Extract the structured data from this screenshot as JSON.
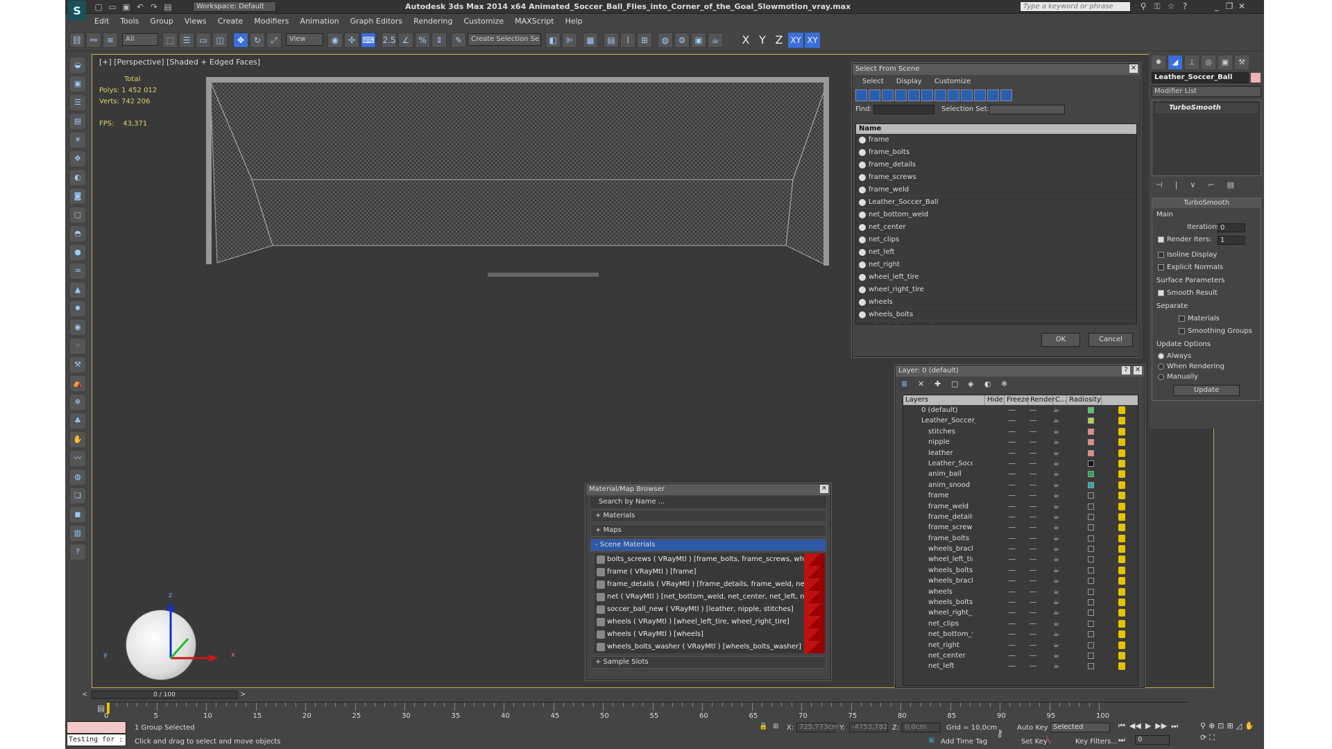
{
  "app": {
    "title": "Autodesk 3ds Max  2014 x64     Animated_Soccer_Ball_Flies_into_Corner_of_the_Goal_Slowmotion_vray.max",
    "workspace": "Workspace: Default",
    "search_placeholder": "Type a keyword or phrase"
  },
  "menu": [
    "Edit",
    "Tools",
    "Group",
    "Views",
    "Create",
    "Modifiers",
    "Animation",
    "Graph Editors",
    "Rendering",
    "Customize",
    "MAXScript",
    "Help"
  ],
  "toolbar": {
    "filter": "All",
    "refcoord": "View",
    "angle": "2.5",
    "selection_set": "Create Selection Se",
    "axes": [
      "X",
      "Y",
      "Z",
      "XY",
      "XY"
    ]
  },
  "viewport": {
    "label": "[+] [Perspective] [Shaded + Edged Faces]",
    "stats_header": "Total",
    "polys_label": "Polys:",
    "polys": "1 452 012",
    "verts_label": "Verts:",
    "verts": "742 206",
    "fps_label": "FPS:",
    "fps": "43,371",
    "axis_x": "x",
    "axis_y": "y",
    "axis_z": "z"
  },
  "select_from_scene": {
    "title": "Select From Scene",
    "menu": [
      "Select",
      "Display",
      "Customize"
    ],
    "find_label": "Find:",
    "selection_set_label": "Selection Set:",
    "column_name": "Name",
    "items": [
      "frame",
      "frame_bolts",
      "frame_details",
      "frame_screws",
      "frame_weld",
      "Leather_Soccer_Ball",
      "net_bottom_weld",
      "net_center",
      "net_clips",
      "net_left",
      "net_right",
      "wheel_left_tire",
      "wheel_right_tire",
      "wheels",
      "wheels_bolts",
      "wheels_bolts_washer"
    ],
    "ok": "OK",
    "cancel": "Cancel"
  },
  "material_browser": {
    "title": "Material/Map Browser",
    "search": "Search by Name ...",
    "materials": "+ Materials",
    "maps": "+ Maps",
    "scene_materials": "- Scene Materials",
    "sample_slots": "+ Sample Slots",
    "items": [
      "bolts_screws  ( VRayMtl ) [frame_bolts, frame_screws, wheels_bolts, wheels_br...",
      "frame  ( VRayMtl ) [frame]",
      "frame_details  ( VRayMtl ) [frame_details, frame_weld, net_clips, wheels_bracket]",
      "net  ( VRayMtl ) [net_bottom_weld, net_center, net_left, net_right]",
      "soccer_ball_new  ( VRayMtl ) [leather, nipple, stitches]",
      "wheels  ( VRayMtl ) [wheel_left_tire, wheel_right_tire]",
      "wheels  ( VRayMtl ) [wheels]",
      "wheels_bolts_washer  ( VRayMtl ) [wheels_bolts_washer]"
    ]
  },
  "layers": {
    "title": "Layer: 0 (default)",
    "help": "?",
    "columns": [
      "Layers",
      "Hide",
      "Freeze",
      "Render",
      "C...",
      "Radiosity"
    ],
    "rows": [
      {
        "name": "0 (default)",
        "level": 0,
        "color": "#44cc66"
      },
      {
        "name": "Leather_Soccer_Bal",
        "level": 0,
        "color": "#aadd44"
      },
      {
        "name": "stitches",
        "level": 1,
        "color": "#ee8888"
      },
      {
        "name": "nipple",
        "level": 1,
        "color": "#ee8888"
      },
      {
        "name": "leather",
        "level": 1,
        "color": "#ee8888"
      },
      {
        "name": "Leather_Soccer_",
        "level": 1,
        "color": "#111111"
      },
      {
        "name": "anim_ball",
        "level": 1,
        "color": "#22aa55"
      },
      {
        "name": "anim_snood",
        "level": 1,
        "color": "#22aaaa"
      },
      {
        "name": "frame",
        "level": 1,
        "color": ""
      },
      {
        "name": "frame_weld",
        "level": 1,
        "color": ""
      },
      {
        "name": "frame_details",
        "level": 1,
        "color": ""
      },
      {
        "name": "frame_screws",
        "level": 1,
        "color": ""
      },
      {
        "name": "frame_bolts",
        "level": 1,
        "color": ""
      },
      {
        "name": "wheels_bracket",
        "level": 1,
        "color": ""
      },
      {
        "name": "wheel_left_tire",
        "level": 1,
        "color": ""
      },
      {
        "name": "wheels_bolts_wa",
        "level": 1,
        "color": ""
      },
      {
        "name": "wheels_bracket_",
        "level": 1,
        "color": ""
      },
      {
        "name": "wheels",
        "level": 1,
        "color": ""
      },
      {
        "name": "wheels_bolts",
        "level": 1,
        "color": ""
      },
      {
        "name": "wheel_right_tire",
        "level": 1,
        "color": ""
      },
      {
        "name": "net_clips",
        "level": 1,
        "color": ""
      },
      {
        "name": "net_bottom_wel",
        "level": 1,
        "color": ""
      },
      {
        "name": "net_right",
        "level": 1,
        "color": ""
      },
      {
        "name": "net_center",
        "level": 1,
        "color": ""
      },
      {
        "name": "net_left",
        "level": 1,
        "color": ""
      }
    ]
  },
  "command_panel": {
    "object_name": "Leather_Soccer_Ball",
    "modifier_list": "Modifier List",
    "stack_item": "TurboSmooth",
    "rollout": "TurboSmooth",
    "main": "Main",
    "iterations_label": "Iterations:",
    "iterations": "0",
    "render_iters_label": "Render Iters:",
    "render_iters": "1",
    "isoline": "Isoline Display",
    "explicit": "Explicit Normals",
    "surface": "Surface Parameters",
    "smooth": "Smooth Result",
    "separate": "Separate",
    "materials": "Materials",
    "smoothing": "Smoothing Groups",
    "update_options": "Update Options",
    "always": "Always",
    "when_rendering": "When Rendering",
    "manually": "Manually",
    "update": "Update"
  },
  "timeline": {
    "slider": "0 / 100",
    "ticks": [
      "0",
      "5",
      "10",
      "15",
      "20",
      "25",
      "30",
      "35",
      "40",
      "45",
      "50",
      "55",
      "60",
      "65",
      "70",
      "75",
      "80",
      "85",
      "90",
      "95",
      "100"
    ]
  },
  "status": {
    "maxscript": "Testing for :",
    "selected": "1 Group Selected",
    "prompt": "Click and drag to select and move objects",
    "x_label": "X:",
    "x": "725,773cm",
    "y_label": "Y:",
    "y": "-4753,782",
    "z_label": "Z:",
    "z": "0,0cm",
    "grid": "Grid = 10,0cm",
    "add_time_tag": "Add Time Tag",
    "auto_key": "Auto Key",
    "key_mode": "Selected",
    "set_key": "Set Key",
    "key_filters": "Key Filters...",
    "frame": "0"
  }
}
